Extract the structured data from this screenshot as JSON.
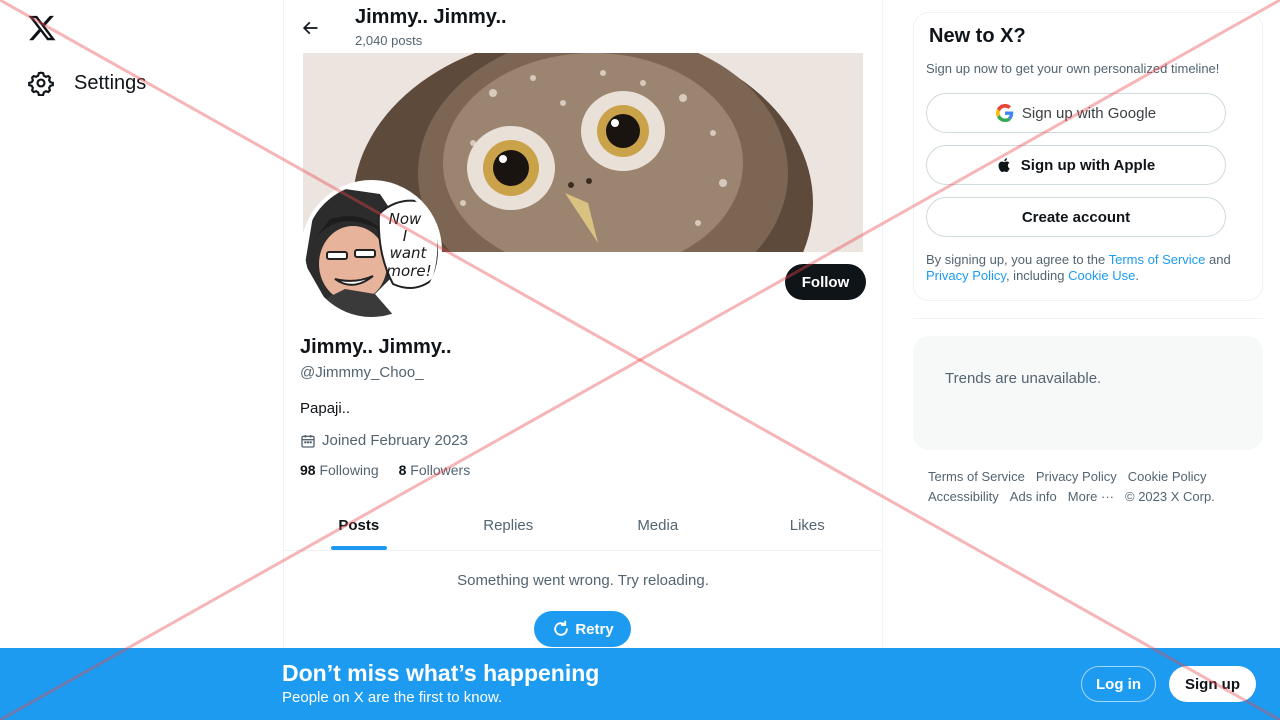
{
  "nav": {
    "logo_icon": "x-logo-icon",
    "settings_icon": "gear-icon",
    "settings_label": "Settings"
  },
  "header": {
    "back_icon": "arrow-left-icon",
    "name": "Jimmy.. Jimmy..",
    "post_count": "2,040 posts"
  },
  "avatar": {
    "speech_line1": "Now",
    "speech_line2": "I",
    "speech_line3": "want",
    "speech_line4": "more!"
  },
  "profile": {
    "follow_label": "Follow",
    "name": "Jimmy.. Jimmy..",
    "handle": "@Jimmmy_Choo_",
    "bio": "Papaji..",
    "joined_icon": "calendar-icon",
    "joined": "Joined February 2023",
    "following_count": "98",
    "following_label": "Following",
    "followers_count": "8",
    "followers_label": "Followers"
  },
  "tabs": [
    {
      "label": "Posts",
      "active": true
    },
    {
      "label": "Replies"
    },
    {
      "label": "Media"
    },
    {
      "label": "Likes"
    }
  ],
  "timeline": {
    "error_text": "Something went wrong. Try reloading.",
    "retry_label": "Retry",
    "retry_icon": "refresh-icon"
  },
  "signup_card": {
    "title": "New to X?",
    "subtitle": "Sign up now to get your own personalized timeline!",
    "google_label": "Sign up with Google",
    "apple_label": "Sign up with Apple",
    "create_label": "Create account",
    "legal_prefix": "By signing up, you agree to the ",
    "terms_link": "Terms of Service",
    "legal_and": " and ",
    "privacy_link": "Privacy Policy",
    "legal_including": ", including ",
    "cookie_link": "Cookie Use",
    "legal_end": "."
  },
  "trends": {
    "message": "Trends are unavailable."
  },
  "footer": {
    "links": [
      "Terms of Service",
      "Privacy Policy",
      "Cookie Policy",
      "Accessibility",
      "Ads info",
      "More ···",
      "© 2023 X Corp."
    ]
  },
  "bottom_bar": {
    "title": "Don’t miss what’s happening",
    "subtitle": "People on X are the first to know.",
    "login_label": "Log in",
    "signup_label": "Sign up"
  },
  "colors": {
    "accent": "#1d9bf0",
    "text": "#0f1419",
    "muted": "#536471",
    "overlay_cross": "#e8454b"
  }
}
